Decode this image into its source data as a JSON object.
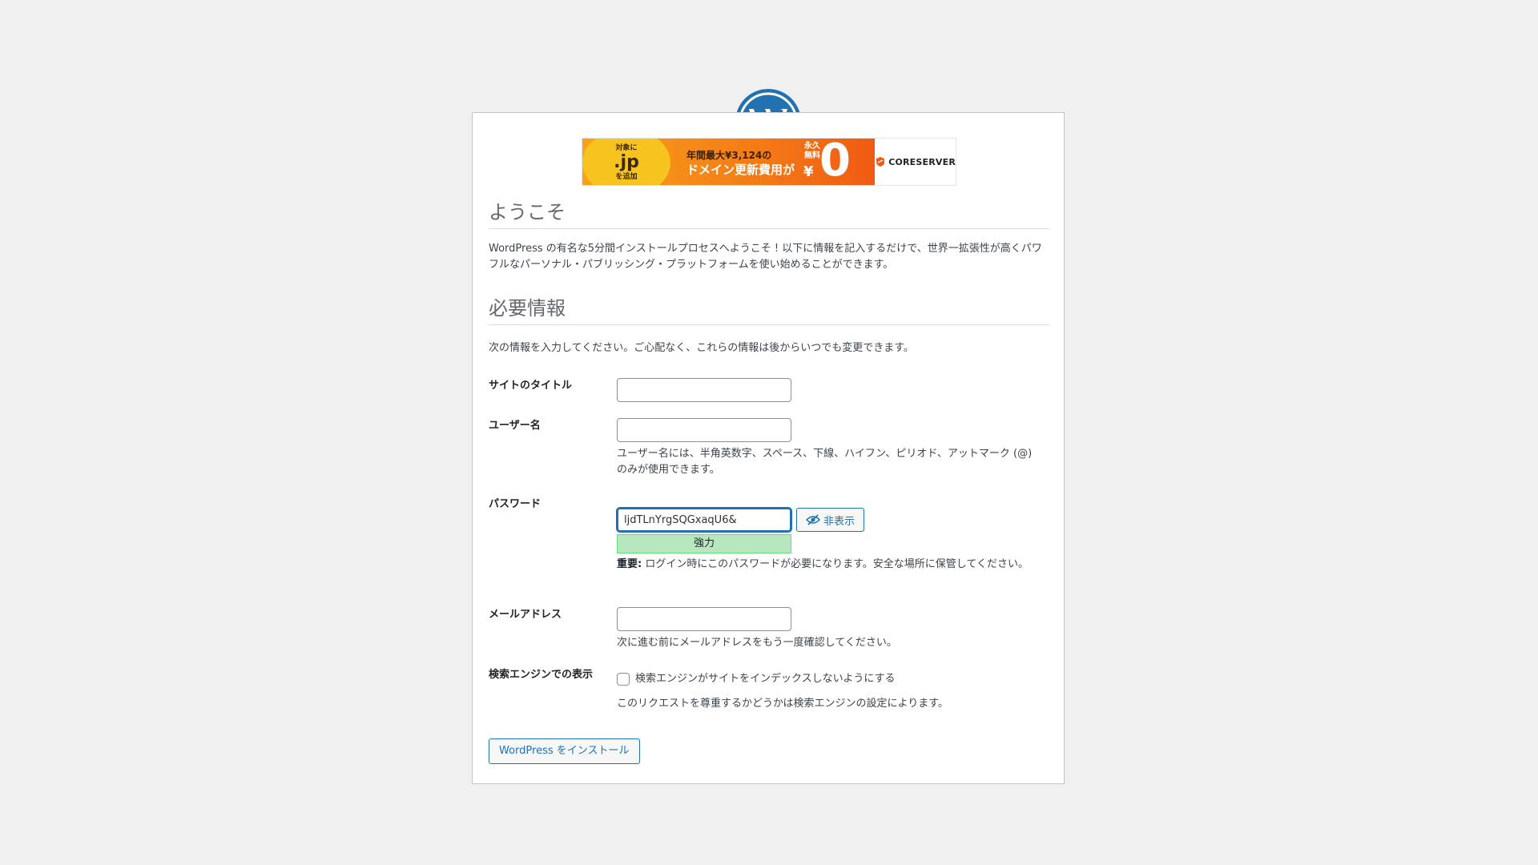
{
  "colors": {
    "background": "#f0f0f1",
    "accent": "#2271b1",
    "strength_bg": "#b8e6bf",
    "logo": "#2271b1"
  },
  "logo": {
    "icon": "wordpress-logo-icon"
  },
  "banner": {
    "jp_top": "対象に",
    "jp_mid": ".jp",
    "jp_bottom": "を追加",
    "line1": "年間最大¥3,124の",
    "line2": "ドメイン更新費用が",
    "forever_1": "永久",
    "forever_2": "無料",
    "yen": "¥",
    "zero": "0",
    "brand": "CORESERVER"
  },
  "welcome": {
    "title": "ようこそ",
    "text": "WordPress の有名な5分間インストールプロセスへようこそ ! 以下に情報を記入するだけで、世界一拡張性が高くパワフルなパーソナル・パブリッシング・プラットフォームを使い始めることができます。"
  },
  "required": {
    "title": "必要情報",
    "text": "次の情報を入力してください。ご心配なく、これらの情報は後からいつでも変更できます。"
  },
  "form": {
    "site_title": {
      "label": "サイトのタイトル",
      "value": ""
    },
    "username": {
      "label": "ユーザー名",
      "value": "",
      "help": "ユーザー名には、半角英数字、スペース、下線、ハイフン、ピリオド、アットマーク (@) のみが使用できます。"
    },
    "password": {
      "label": "パスワード",
      "value": "ljdTLnYrgSQGxaqU6&",
      "hide_button": "非表示",
      "hide_icon": "eye-slash-icon",
      "strength": "強力",
      "important_prefix": "重要:",
      "important_text": " ログイン時にこのパスワードが必要になります。安全な場所に保管してください。"
    },
    "email": {
      "label": "メールアドレス",
      "value": "",
      "help": "次に進む前にメールアドレスをもう一度確認してください。"
    },
    "search_visibility": {
      "label": "検索エンジンでの表示",
      "checkbox_label": "検索エンジンがサイトをインデックスしないようにする",
      "checked": false,
      "help": "このリクエストを尊重するかどうかは検索エンジンの設定によります。"
    },
    "submit": "WordPress をインストール"
  }
}
